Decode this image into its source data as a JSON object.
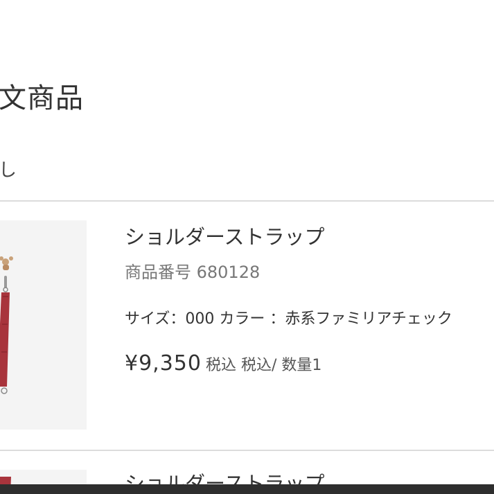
{
  "section": {
    "title": "文商品",
    "sub_text": "し"
  },
  "items": [
    {
      "name": "ショルダーストラップ",
      "item_number": "商品番号 680128",
      "spec": "サイズ：000 カラー ：赤系ファミリアチェック",
      "price": "¥9,350",
      "price_meta": "税込 税込/ 数量1"
    },
    {
      "name": "ショルダーストラップ"
    }
  ],
  "colors": {
    "strap": "#a8343c",
    "thumb_bg": "#f4f4f4",
    "bottom_bar": "#2e2e2e"
  }
}
